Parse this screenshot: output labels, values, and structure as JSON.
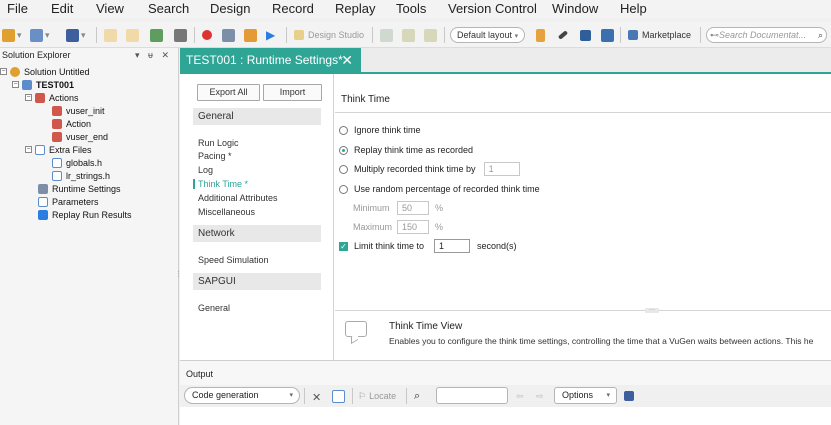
{
  "menu": [
    "File",
    "Edit",
    "View",
    "Search",
    "Design",
    "Record",
    "Replay",
    "Tools",
    "Version Control",
    "Window",
    "Help"
  ],
  "toolbar": {
    "design_studio": "Design Studio",
    "layout": "Default layout",
    "marketplace": "Marketplace",
    "search_placeholder": "Search Documentat..."
  },
  "solution_explorer": {
    "title": "Solution Explorer",
    "controls": "▾ ᵾ ✕",
    "tree": [
      {
        "label": "Solution Untitled"
      },
      {
        "label": "TEST001"
      },
      {
        "label": "Actions"
      },
      {
        "label": "vuser_init"
      },
      {
        "label": "Action"
      },
      {
        "label": "vuser_end"
      },
      {
        "label": "Extra Files"
      },
      {
        "label": "globals.h"
      },
      {
        "label": "lr_strings.h"
      },
      {
        "label": "Runtime Settings"
      },
      {
        "label": "Parameters"
      },
      {
        "label": "Replay Run Results"
      }
    ]
  },
  "tab": {
    "label": "TEST001 : Runtime Settings*",
    "close": "✕"
  },
  "settings_nav": {
    "export_all": "Export All",
    "import": "Import",
    "groups": [
      {
        "label": "General",
        "items": [
          "Run Logic",
          "Pacing *",
          "Log",
          "Think Time *",
          "Additional Attributes",
          "Miscellaneous"
        ]
      },
      {
        "label": "Network",
        "items": [
          "Speed Simulation"
        ]
      },
      {
        "label": "SAPGUI",
        "items": [
          "General"
        ]
      }
    ],
    "active_item": "Think Time *"
  },
  "think_time": {
    "title": "Think Time",
    "ignore": "Ignore think time",
    "replay": "Replay think time as recorded",
    "multiply": "Multiply recorded think time by",
    "multiply_value": "1",
    "random": "Use random percentage of recorded think time",
    "minimum_label": "Minimum",
    "minimum_value": "50",
    "maximum_label": "Maximum",
    "maximum_value": "150",
    "percent": "%",
    "limit": "Limit think time to",
    "limit_value": "1",
    "limit_unit": "second(s)",
    "selected": "replay",
    "limit_checked": true
  },
  "help": {
    "title": "Think Time View",
    "description": "Enables you to configure the think time settings, controlling the time that a VuGen waits between actions. This he"
  },
  "output": {
    "title": "Output",
    "source": "Code generation",
    "locate": "Locate",
    "options": "Options"
  },
  "colors": {
    "accent": "#2fa596"
  }
}
